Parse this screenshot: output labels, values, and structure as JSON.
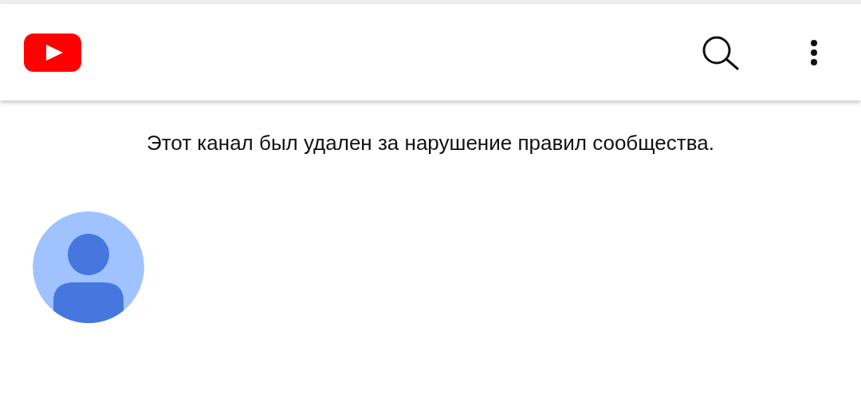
{
  "message": "Этот канал был удален за нарушение правил сообщества."
}
